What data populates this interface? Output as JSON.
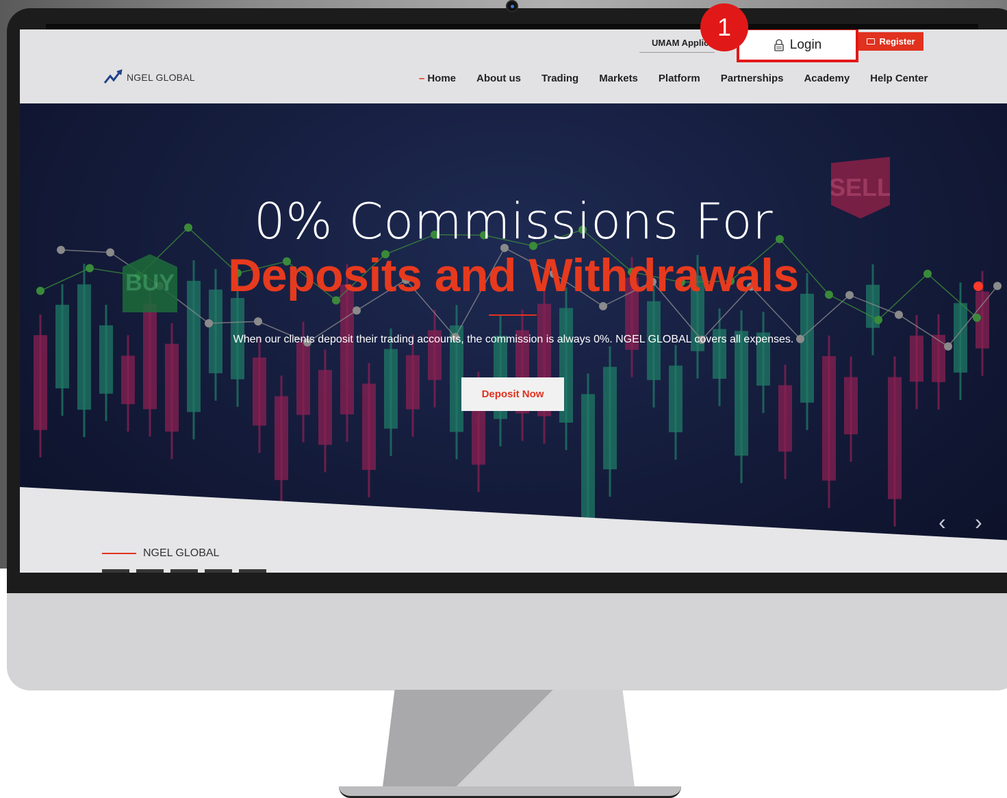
{
  "header": {
    "logo_text": "NGEL GLOBAL",
    "umam_label": "UMAM Applic",
    "login_label": "Login",
    "register_label": "Register",
    "step_badge": "1",
    "nav": [
      "Home",
      "About us",
      "Trading",
      "Markets",
      "Platform",
      "Partnerships",
      "Academy",
      "Help Center"
    ]
  },
  "hero": {
    "title_line1": "0% Commissions For",
    "title_line2": "Deposits and Withdrawals",
    "description": "When our clients deposit their trading accounts, the commission is always 0%. NGEL GLOBAL covers all expenses.",
    "cta_label": "Deposit Now",
    "sell_label": "SELL",
    "buy_label": "BUY",
    "prev_arrow": "‹",
    "next_arrow": "›"
  },
  "section": {
    "label": "NGEL GLOBAL"
  },
  "colors": {
    "accent_red": "#e0321f",
    "hero_bg": "#141b3a",
    "candle_green": "#1f7a66",
    "candle_red": "#8a2052"
  },
  "icons": {
    "login": "lock-icon",
    "register": "card-icon",
    "prev": "chevron-left-icon",
    "next": "chevron-right-icon"
  }
}
